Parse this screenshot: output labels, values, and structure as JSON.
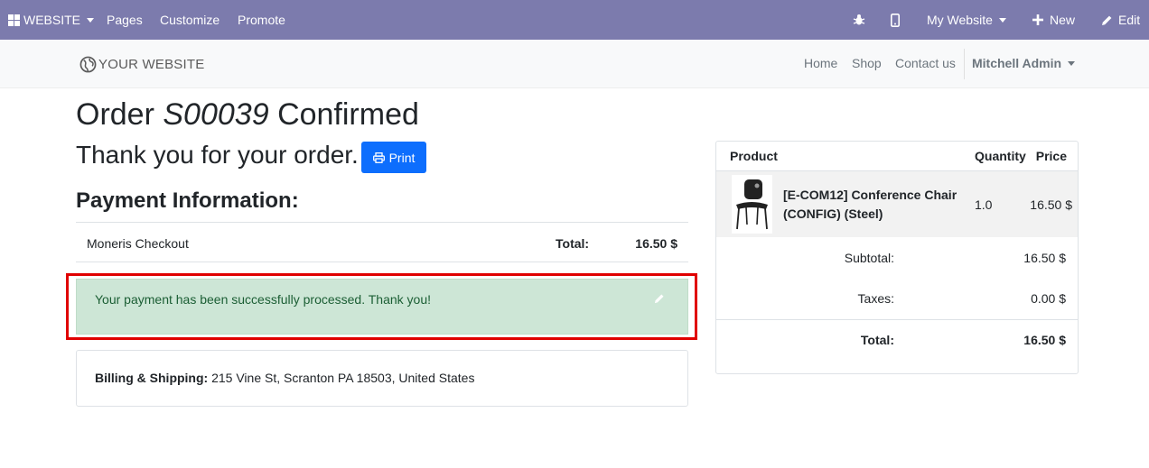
{
  "adminbar": {
    "apps_label": "WEBSITE",
    "menu": [
      "Pages",
      "Customize",
      "Promote"
    ],
    "website_selector": "My Website",
    "new_label": "New",
    "edit_label": "Edit"
  },
  "site": {
    "logo_text": "YOUR WEBSITE",
    "nav": [
      "Home",
      "Shop",
      "Contact us"
    ],
    "user": "Mitchell Admin"
  },
  "order": {
    "title_prefix": "Order",
    "number": "S00039",
    "title_suffix": "Confirmed",
    "thanks": "Thank you for your order.",
    "print_label": "Print"
  },
  "payment": {
    "heading": "Payment Information:",
    "method": "Moneris Checkout",
    "total_label": "Total:",
    "total_value": "16.50 $",
    "success_message": "Your payment has been successfully processed. Thank you!"
  },
  "billing": {
    "label": "Billing & Shipping:",
    "address": "215 Vine St, Scranton PA 18503, United States"
  },
  "summary": {
    "headers": {
      "product": "Product",
      "quantity": "Quantity",
      "price": "Price"
    },
    "line": {
      "name": "[E-COM12] Conference Chair (CONFIG) (Steel)",
      "quantity": "1.0",
      "price": "16.50 $"
    },
    "subtotal_label": "Subtotal:",
    "subtotal_value": "16.50 $",
    "taxes_label": "Taxes:",
    "taxes_value": "0.00 $",
    "total_label": "Total:",
    "total_value": "16.50 $"
  },
  "colors": {
    "admin_bar": "#7c7bad",
    "primary_button": "#0d6efd",
    "success_alert": "#cde6d6",
    "highlight_border": "#e00000"
  }
}
